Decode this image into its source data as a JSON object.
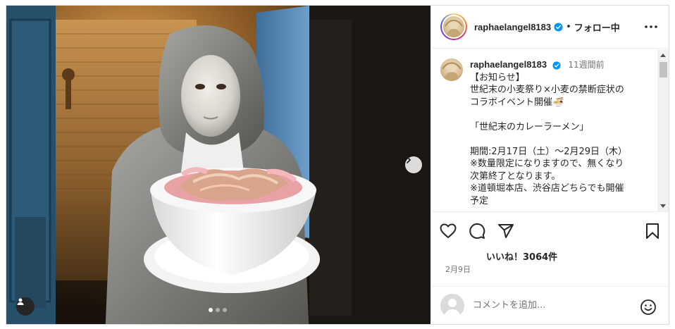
{
  "post": {
    "image_alt": "photo",
    "carousel": {
      "total": 3,
      "current": 1
    }
  },
  "header": {
    "username": "raphaelangel8183",
    "separator": "•",
    "follow_label": "フォロー中"
  },
  "caption": {
    "username": "raphaelangel8183",
    "time": "11週間前",
    "lines": [
      "【お知らせ】",
      "世紀末の小麦祭り×小麦の禁断症状の",
      "コラボイベント開催🍜",
      "",
      "「世紀末のカレーラーメン」",
      "",
      "期間:2月17日（土）～2月29日（木）",
      "※数量限定になりますので、無くなり",
      "次第終了となります。",
      "※道頓堀本店、渋谷店どちらでも開催",
      "予定"
    ]
  },
  "stats": {
    "likes_text": "いいね！3064件",
    "date": "2月9日"
  },
  "comment": {
    "placeholder": "コメントを追加..."
  },
  "icons": {
    "like": "heart-icon",
    "comment": "comment-icon",
    "share": "share-icon",
    "save": "bookmark-icon",
    "more": "more-horizontal-icon",
    "next": "chevron-right-icon",
    "tag": "user-tag-icon",
    "emoji": "emoji-icon",
    "verified": "verified-badge-icon"
  },
  "colors": {
    "text": "#262626",
    "muted": "#737373",
    "border": "#dbdbdb",
    "verified": "#0095f6"
  }
}
